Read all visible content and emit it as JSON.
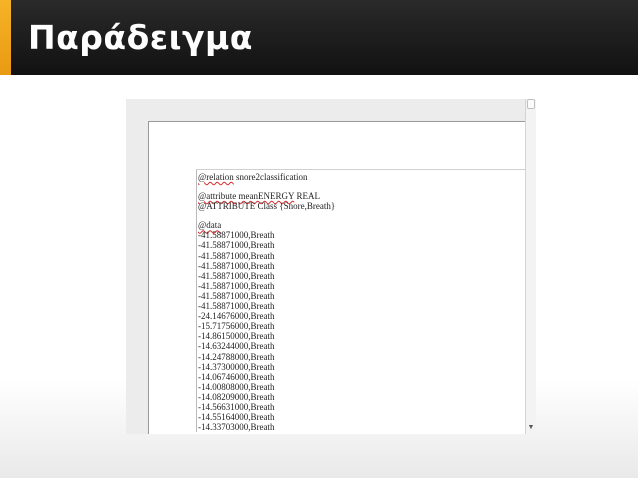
{
  "slide": {
    "title": "Παράδειγμα"
  },
  "document": {
    "relation_keyword": "@relation",
    "relation_name": "snore2classification",
    "attr1_keyword": "@attribute",
    "attr1_name": "meanENERGY",
    "attr1_type": "REAL",
    "attr2_text": "@ATTRIBUTE Class {Snore,Breath}",
    "data_keyword": "@data",
    "rows": [
      "-41.58871000,Breath",
      "-41.58871000,Breath",
      "-41.58871000,Breath",
      "-41.58871000,Breath",
      "-41.58871000,Breath",
      "-41.58871000,Breath",
      "-41.58871000,Breath",
      "-41.58871000,Breath",
      "-24.14676000,Breath",
      "-15.71756000,Breath",
      "-14.86150000,Breath",
      "-14.63244000,Breath",
      "-14.24788000,Breath",
      "-14.37300000,Breath",
      "-14.06746000,Breath",
      "-14.00808000,Breath",
      "-14.08209000,Breath",
      "-14.56631000,Breath",
      "-14.55164000,Breath",
      "-14.33703000,Breath"
    ]
  },
  "icons": {
    "scroll_down": "scroll-down-arrow-icon"
  }
}
